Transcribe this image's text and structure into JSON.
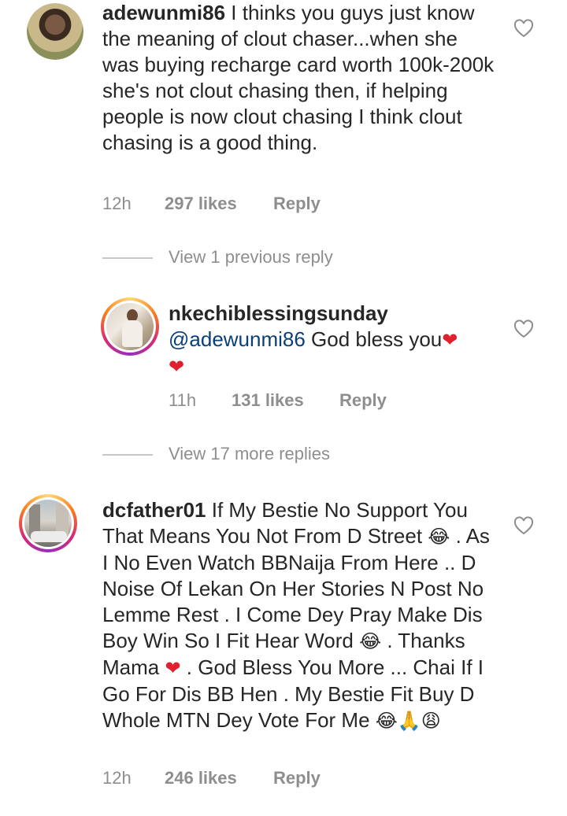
{
  "comments": [
    {
      "username": "adewunmi86",
      "text": " I thinks you guys just know the meaning of clout chaser...when she was buying recharge card worth 100k-200k she's not clout chasing then, if helping people is now clout chasing I think clout chasing is a good thing.",
      "time": "12h",
      "likes": "297 likes",
      "reply": "Reply"
    },
    {
      "view_replies": "View 1 previous reply",
      "username": "nkechiblessingsunday",
      "mention": "@adewunmi86",
      "text": " God bless you",
      "time": "11h",
      "likes": "131 likes",
      "reply": "Reply"
    },
    {
      "view_replies": "View 17 more replies"
    },
    {
      "username": "dcfather01",
      "text_1": " If My Bestie No Support You That Means You Not From D Street ",
      "text_2": " . As I No Even Watch BBNaija From Here .. D Noise Of Lekan On Her Stories N Post No Lemme Rest . I Come Dey Pray Make Dis Boy Win So I Fit Hear Word ",
      "text_3": " . Thanks Mama ",
      "text_4": " . God Bless You More ... Chai If I Go For Dis BB Hen . My Bestie Fit Buy D Whole MTN Dey Vote For Me ",
      "time": "12h",
      "likes": "246 likes",
      "reply": "Reply"
    }
  ],
  "emojis": {
    "laugh": "😂",
    "pray": "🙏",
    "weary": "😩",
    "heart": "❤"
  },
  "colors": {
    "text": "#262626",
    "meta": "#8e8e8e",
    "mention": "#0b3f7a",
    "heart_red": "#e0202e"
  }
}
